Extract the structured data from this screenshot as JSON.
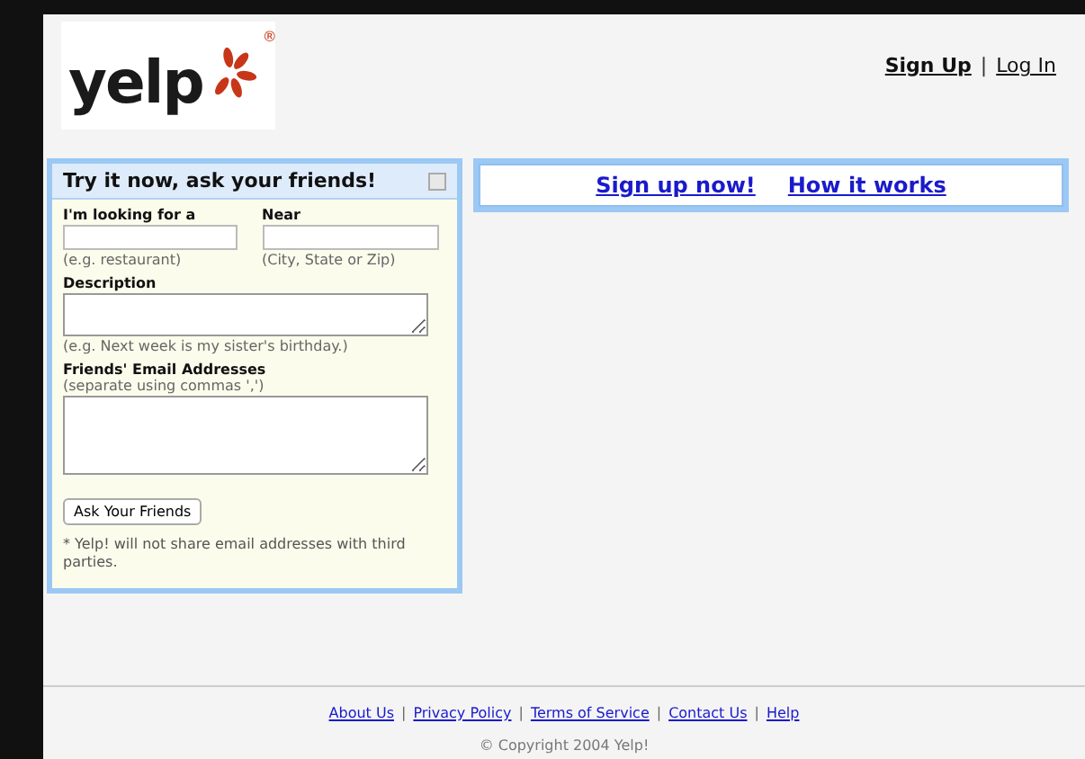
{
  "header": {
    "logo": {
      "text": "yelp",
      "mark": "®"
    },
    "account_links": [
      {
        "kind": "link",
        "text": "Sign Up",
        "bold": true
      },
      {
        "kind": "separator",
        "text": "|"
      },
      {
        "kind": "link",
        "text": "Log In",
        "bold": false
      }
    ]
  },
  "ask_panel": {
    "title": "Try it now, ask your friends!",
    "fields": [
      {
        "kind": "input",
        "label": "I'm looking for a",
        "hint": "(e.g. restaurant)"
      },
      {
        "kind": "input",
        "label": "Near",
        "hint": "(City, State or Zip)"
      },
      {
        "kind": "short_textarea",
        "label": "Description",
        "hint": "(e.g. Next week is my sister's birthday.)"
      },
      {
        "kind": "tall_textarea",
        "label": "Friends' Email Addresses",
        "subhint": "(separate using commas ',')"
      }
    ],
    "button": "Ask Your Friends",
    "note": "* Yelp! will not share email addresses with third parties."
  },
  "promo_links": [
    "Sign up now!",
    "How it works"
  ],
  "footer": {
    "links": [
      {
        "kind": "link",
        "text": "About Us"
      },
      {
        "kind": "separator",
        "text": "|"
      },
      {
        "kind": "link",
        "text": "Privacy Policy"
      },
      {
        "kind": "separator",
        "text": "|"
      },
      {
        "kind": "link",
        "text": "Terms of Service"
      },
      {
        "kind": "separator",
        "text": "|"
      },
      {
        "kind": "link",
        "text": "Contact Us"
      },
      {
        "kind": "separator",
        "text": "|"
      },
      {
        "kind": "link",
        "text": "Help"
      }
    ],
    "copyright": "© Copyright 2004 Yelp!"
  }
}
